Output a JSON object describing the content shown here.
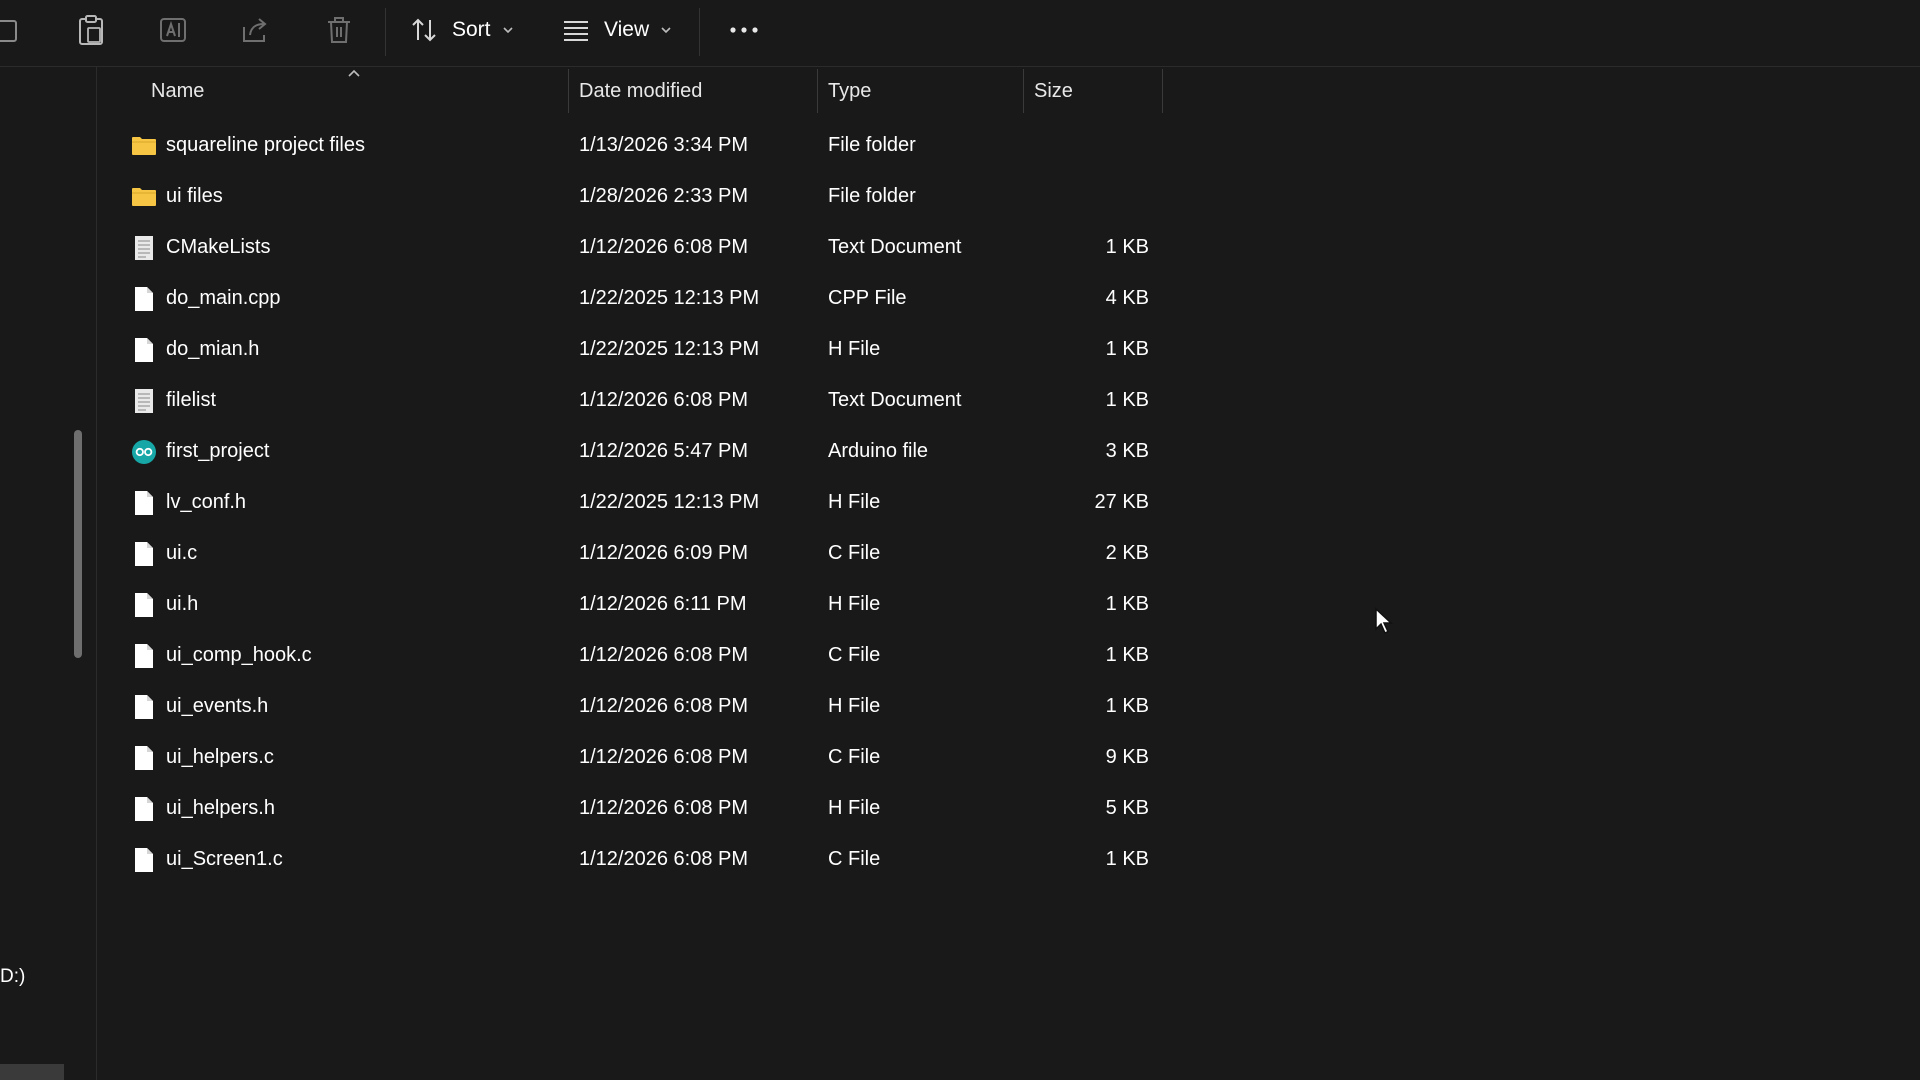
{
  "toolbar": {
    "sort_label": "Sort",
    "view_label": "View"
  },
  "nav": {
    "drive_label": "D:)"
  },
  "columns": {
    "name": "Name",
    "date": "Date modified",
    "type": "Type",
    "size": "Size"
  },
  "files": [
    {
      "name": "squareline project files",
      "date": "1/13/2026 3:34 PM",
      "type": "File folder",
      "size": "",
      "icon": "folder-icon"
    },
    {
      "name": "ui files",
      "date": "1/28/2026 2:33 PM",
      "type": "File folder",
      "size": "",
      "icon": "folder-icon"
    },
    {
      "name": "CMakeLists",
      "date": "1/12/2026 6:08 PM",
      "type": "Text Document",
      "size": "1 KB",
      "icon": "text-file-icon"
    },
    {
      "name": "do_main.cpp",
      "date": "1/22/2025 12:13 PM",
      "type": "CPP File",
      "size": "4 KB",
      "icon": "file-icon"
    },
    {
      "name": "do_mian.h",
      "date": "1/22/2025 12:13 PM",
      "type": "H File",
      "size": "1 KB",
      "icon": "file-icon"
    },
    {
      "name": "filelist",
      "date": "1/12/2026 6:08 PM",
      "type": "Text Document",
      "size": "1 KB",
      "icon": "text-file-icon"
    },
    {
      "name": "first_project",
      "date": "1/12/2026 5:47 PM",
      "type": "Arduino file",
      "size": "3 KB",
      "icon": "arduino-icon"
    },
    {
      "name": "lv_conf.h",
      "date": "1/22/2025 12:13 PM",
      "type": "H File",
      "size": "27 KB",
      "icon": "file-icon"
    },
    {
      "name": "ui.c",
      "date": "1/12/2026 6:09 PM",
      "type": "C File",
      "size": "2 KB",
      "icon": "file-icon"
    },
    {
      "name": "ui.h",
      "date": "1/12/2026 6:11 PM",
      "type": "H File",
      "size": "1 KB",
      "icon": "file-icon"
    },
    {
      "name": "ui_comp_hook.c",
      "date": "1/12/2026 6:08 PM",
      "type": "C File",
      "size": "1 KB",
      "icon": "file-icon"
    },
    {
      "name": "ui_events.h",
      "date": "1/12/2026 6:08 PM",
      "type": "H File",
      "size": "1 KB",
      "icon": "file-icon"
    },
    {
      "name": "ui_helpers.c",
      "date": "1/12/2026 6:08 PM",
      "type": "C File",
      "size": "9 KB",
      "icon": "file-icon"
    },
    {
      "name": "ui_helpers.h",
      "date": "1/12/2026 6:08 PM",
      "type": "H File",
      "size": "5 KB",
      "icon": "file-icon"
    },
    {
      "name": "ui_Screen1.c",
      "date": "1/12/2026 6:08 PM",
      "type": "C File",
      "size": "1 KB",
      "icon": "file-icon"
    }
  ],
  "colors": {
    "background": "#191919",
    "folder": "#f6c543",
    "arduino": "#17a7a7"
  }
}
